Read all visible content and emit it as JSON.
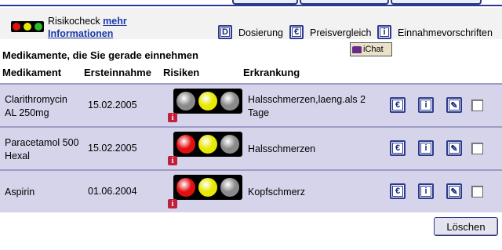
{
  "legend": {
    "risk_label": "Risikocheck",
    "more_link_1": "mehr",
    "more_link_2": "Informationen",
    "dosage_icon": "D",
    "dosage_label": "Dosierung",
    "price_icon": "€",
    "price_label": "Preisvergleich",
    "intake_icon": "i",
    "intake_label": "Einnahmevorschriften"
  },
  "chat_label": "iChat",
  "section_title": "Medikamente, die Sie gerade einnehmen",
  "columns": {
    "medication": "Medikament",
    "first_intake": "Ersteinnahme",
    "risks": "Risiken",
    "condition": "Erkrankung"
  },
  "rows": [
    {
      "med_line1": "Clarithromycin",
      "med_line2": "AL 250mg",
      "date": "15.02.2005",
      "lights": [
        "grey",
        "yellow",
        "grey"
      ],
      "cond_line1": "Halsschmerzen,laeng.als 2",
      "cond_line2": "Tage",
      "checked": false
    },
    {
      "med_line1": "Paracetamol 500",
      "med_line2": "Hexal",
      "date": "15.02.2005",
      "lights": [
        "red",
        "yellow",
        "grey"
      ],
      "cond_line1": "Halsschmerzen",
      "cond_line2": "",
      "checked": false
    },
    {
      "med_line1": "Aspirin",
      "med_line2": "",
      "date": "01.06.2004",
      "lights": [
        "red",
        "yellow",
        "grey"
      ],
      "cond_line1": "Kopfschmerz",
      "cond_line2": "",
      "checked": false
    }
  ],
  "action_icons": {
    "price": "€",
    "info": "i",
    "edit": "✎"
  },
  "info_badge": "i",
  "delete_label": "Löschen",
  "colors": {
    "red": "#e01010",
    "yellow": "#e8e800",
    "grey": "#8a8a8a",
    "row_bg": "#d5d4ea",
    "accent": "#2b3a8c"
  }
}
